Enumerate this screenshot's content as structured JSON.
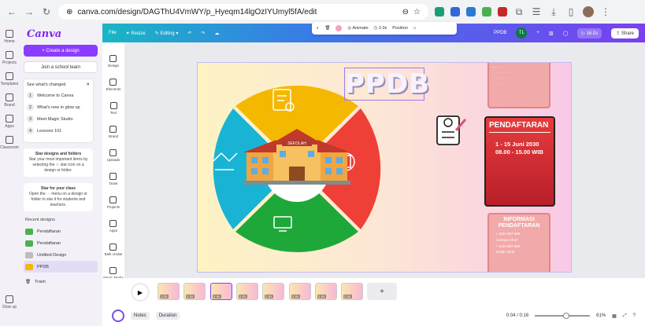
{
  "browser": {
    "url": "canva.com/design/DAGThU4VmWY/p_Hyeqm14lgOzIYUmyl5fA/edit"
  },
  "rail": [
    {
      "label": "Home"
    },
    {
      "label": "Projects"
    },
    {
      "label": "Templates"
    },
    {
      "label": "Brand"
    },
    {
      "label": "Apps"
    },
    {
      "label": "Classroom"
    },
    {
      "label": "Glow up"
    }
  ],
  "sidepanel": {
    "logo": "Canva",
    "create_label": "+ Create a design",
    "join_label": "Join a school team",
    "whats_changed": "See what's changed",
    "steps": [
      {
        "num": "1",
        "label": "Welcome to Canva"
      },
      {
        "num": "2",
        "label": "What's new in glow up"
      },
      {
        "num": "3",
        "label": "Meet Magic Studio"
      },
      {
        "num": "4",
        "label": "Lessons 101"
      }
    ],
    "star_title": "Star designs and folders",
    "star_body": "Star your most important items by selecting the ☆ star icon on a design or folder.",
    "star2_title": "Star for your class",
    "star2_body": "Open the ··· menu on a design or folder to star it for students and teachers.",
    "recent_heading": "Recent designs",
    "recent": [
      {
        "label": "Pendaftaran"
      },
      {
        "label": "Pendaftaran"
      },
      {
        "label": "Untitled Design"
      },
      {
        "label": "PPDB"
      }
    ],
    "trash_label": "Trash"
  },
  "topbar": {
    "file": "File",
    "resize": "✦ Resize",
    "editing": "✎ Editing ▾",
    "doc_name": "PPDB",
    "avatar_initials": "TL",
    "timer": "▷ 16.0s",
    "share": "⇪ Share"
  },
  "tools": [
    {
      "label": "Design"
    },
    {
      "label": "Elements"
    },
    {
      "label": "Text"
    },
    {
      "label": "Brand"
    },
    {
      "label": "Uploads"
    },
    {
      "label": "Draw"
    },
    {
      "label": "Projects"
    },
    {
      "label": "Apps"
    },
    {
      "label": "Bulk create"
    },
    {
      "label": "Magic Media"
    },
    {
      "label": "Magic Write"
    }
  ],
  "ctx_toolbar": {
    "animate": "Animate",
    "duration": "2.0s",
    "position": "Position"
  },
  "canvas": {
    "title": "PPDB",
    "school_sign": "SEKOLAH",
    "pendaftaran_heading": "PENDAFTARAN",
    "dates": "1 - 15 Juni 2030",
    "hours": "08.00 - 15.00 WIB",
    "info_heading": "INFORMASI PENDAFTARAN",
    "info_lines": [
      "• 1234 567 890",
      "Cahaya Shar!",
      "• 1234 567 890",
      "Kotak Surat"
    ],
    "colors": {
      "yellow": "#f5b800",
      "red": "#ef4038",
      "green": "#1fa83a",
      "cyan": "#19b4d4"
    }
  },
  "timeline": {
    "pages": [
      "2.0s",
      "2.0s",
      "2.0s",
      "2.0s",
      "2.0s",
      "2.0s",
      "2.0s",
      "2.0s"
    ],
    "add": "+"
  },
  "status": {
    "notes": "Notes",
    "duration": "Duration",
    "time": "0:04 / 0:16",
    "zoom": "61%"
  }
}
